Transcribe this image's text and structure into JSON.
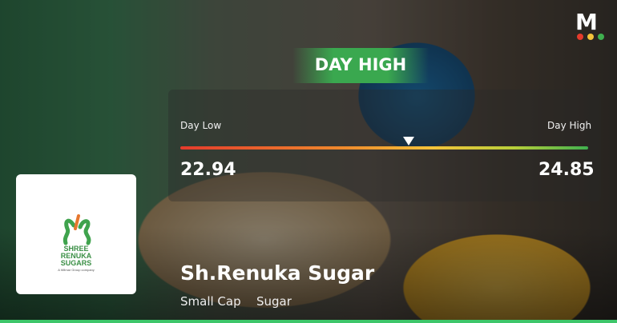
{
  "banner": {
    "title": "DAY HIGH"
  },
  "range": {
    "low_label": "Day Low",
    "high_label": "Day High",
    "low_value": "22.94",
    "high_value": "24.85",
    "marker_fraction": 0.56
  },
  "stock": {
    "name": "Sh.Renuka Sugar",
    "category": "Small Cap",
    "sector": "Sugar",
    "logo_text_line1": "SHREE",
    "logo_text_line2": "RENUKA",
    "logo_text_line3": "SUGARS",
    "logo_tagline": "A Wilmar Group company"
  },
  "brand": {
    "letter": "M"
  },
  "colors": {
    "accent_green": "#3aa84f",
    "bar_low": "#e53b2c",
    "bar_high": "#3fb04f"
  }
}
